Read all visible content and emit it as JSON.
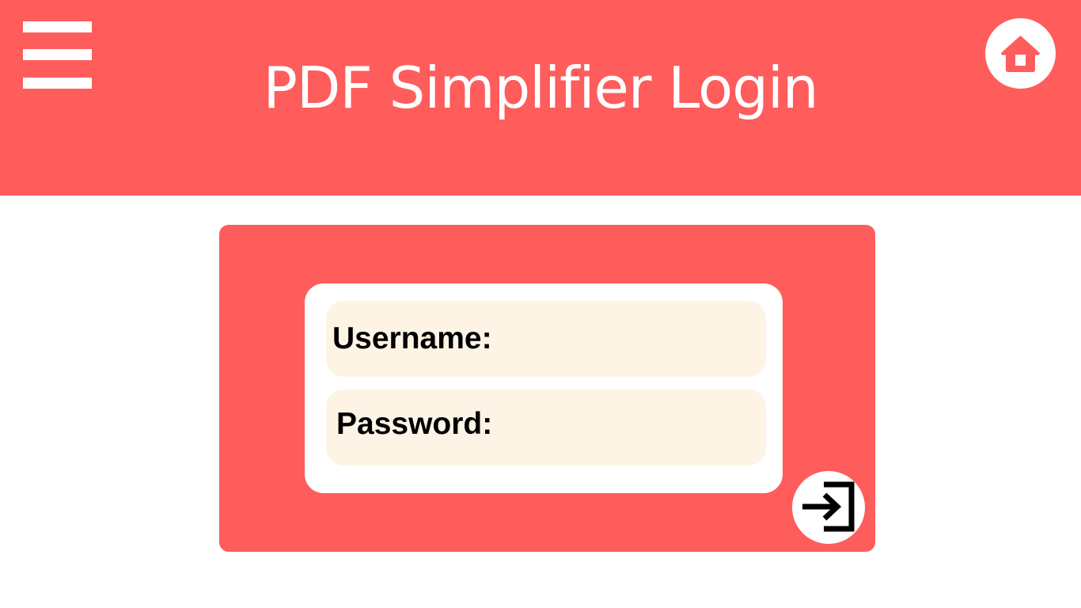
{
  "header": {
    "title": "PDF Simplifier Login",
    "menu_icon": "hamburger-menu-icon",
    "home_icon": "home-icon"
  },
  "login_form": {
    "username_label": "Username:",
    "password_label": "Password:",
    "submit_icon": "login-arrow-icon"
  },
  "colors": {
    "accent": "#ff5c5c",
    "field_background": "#fdf4e6",
    "panel_background": "#ffffff",
    "text": "#000000"
  }
}
